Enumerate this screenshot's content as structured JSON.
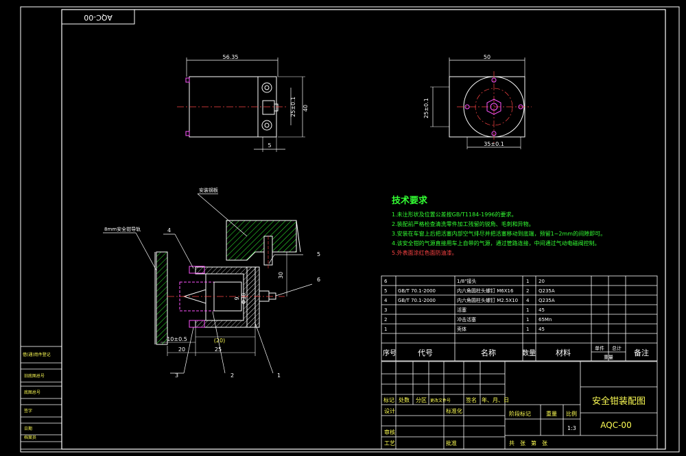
{
  "drawing": {
    "corner_code": "AQC-00",
    "title": "安全钳装配图",
    "drawing_no": "AQC-00",
    "scale": "1:3"
  },
  "dimensions": {
    "side_width": "56.35",
    "side_height": "40",
    "side_inner": "25±0.1",
    "side_bottom": "5",
    "front_width": "50",
    "front_height": "25±0.1",
    "front_bottom": "35±0.1",
    "sec_h30": "30",
    "sec_phi": "Φ30",
    "sec_h9": "9",
    "sec_20a": "20",
    "sec_20b": "(20)",
    "sec_25": "25",
    "sec_tol": "10±0.5"
  },
  "callouts": {
    "c1": "1",
    "c2": "2",
    "c3": "3",
    "c4": "4",
    "c5": "5",
    "c6": "6",
    "guide_rail": "8mm安全钳导轨",
    "mount_plate": "安装钢板"
  },
  "tech": {
    "heading": "技术要求",
    "lines": [
      "1.未注形状及位置公差按GB/T1184-1996的要求。",
      "2.装配前严格检查清洗零件加工残留的锐角、毛刺和异物。",
      "3.安装在车窗上后把活塞内部空气排尽并把活塞移动到底端，预留1~2mm的间隙即可。",
      "4.该安全钳的气源直接用车上自带的气源，通过管路连接，中间通过气动电磁阀控制。",
      "5.外表面涂红色面防油漆。"
    ]
  },
  "bom": {
    "rows": [
      {
        "no": "6",
        "code": "",
        "name": "1/8\"接头",
        "qty": "1",
        "mat": "20"
      },
      {
        "no": "5",
        "code": "GB/T 70.1-2000",
        "name": "内六角圆柱头螺钉 M6X16",
        "qty": "2",
        "mat": "Q235A"
      },
      {
        "no": "4",
        "code": "GB/T 70.1-2000",
        "name": "内六角圆柱头螺钉 M2.5X10",
        "qty": "4",
        "mat": "Q235A"
      },
      {
        "no": "3",
        "code": "",
        "name": "活塞",
        "qty": "1",
        "mat": "45"
      },
      {
        "no": "2",
        "code": "",
        "name": "冲击活塞",
        "qty": "1",
        "mat": "65Mn"
      },
      {
        "no": "1",
        "code": "",
        "name": "壳体",
        "qty": "1",
        "mat": "45"
      }
    ],
    "header": {
      "no": "序号",
      "code": "代号",
      "name": "名称",
      "qty": "数量",
      "mat": "材料",
      "single": "单件",
      "total": "总计",
      "weight": "重量",
      "remark": "备注"
    }
  },
  "titleblock": {
    "mark": "标记",
    "count": "处数",
    "zone": "分区",
    "docno": "更改文件号",
    "sign": "签名",
    "date": "年、月、日",
    "design": "设计",
    "standard": "标准化",
    "stage": "阶段标记",
    "weight": "重量",
    "scale_lbl": "比例",
    "review": "审核",
    "process": "工艺",
    "approve": "批准",
    "sheets": "共　张　第　张"
  },
  "sidebox": {
    "r1": "借(通)用件登记",
    "r2": "旧底图总号",
    "r3": "底图总号",
    "r4": "签字",
    "r5": "日期",
    "r6": "档案员"
  }
}
